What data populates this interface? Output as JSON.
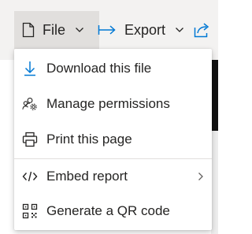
{
  "toolbar": {
    "file_label": "File",
    "export_label": "Export"
  },
  "menu": {
    "items": [
      {
        "label": "Download this file",
        "icon": "download-icon"
      },
      {
        "label": "Manage permissions",
        "icon": "manage-permissions-icon"
      },
      {
        "label": "Print this page",
        "icon": "printer-icon"
      },
      {
        "label": "Embed report",
        "icon": "code-icon",
        "has_submenu": true
      },
      {
        "label": "Generate a QR code",
        "icon": "qr-code-icon"
      }
    ]
  },
  "colors": {
    "accent": "#0078d4",
    "text": "#252423",
    "toolbar_bg": "#f3f2f1",
    "active_bg": "#e1dfdd"
  }
}
